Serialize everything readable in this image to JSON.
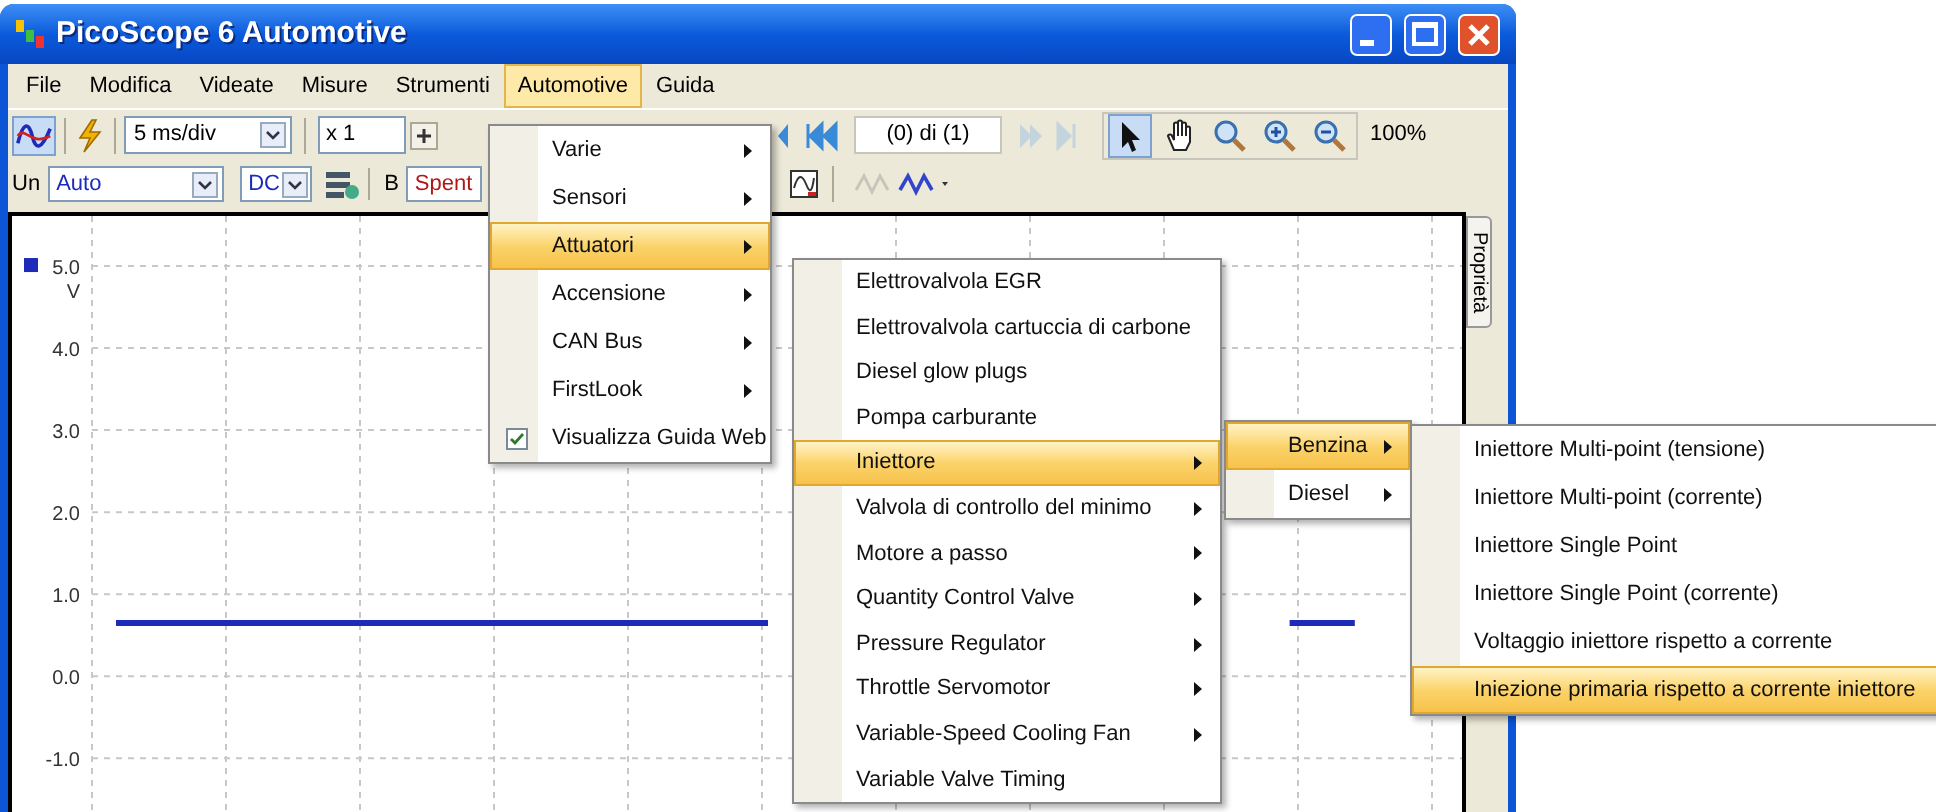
{
  "window": {
    "title": "PicoScope 6 Automotive"
  },
  "menu_bar": [
    {
      "label": "File",
      "selected": false
    },
    {
      "label": "Modifica",
      "selected": false
    },
    {
      "label": "Videate",
      "selected": false
    },
    {
      "label": "Misure",
      "selected": false
    },
    {
      "label": "Strumenti",
      "selected": false
    },
    {
      "label": "Automotive",
      "selected": true
    },
    {
      "label": "Guida",
      "selected": false
    }
  ],
  "toolbar": {
    "timebase": "5 ms/div",
    "multiplier": "x 1",
    "buffer": "(0) di (1)",
    "zoom": "100%",
    "tools": [
      {
        "kind": "pointer",
        "selected": true
      },
      {
        "kind": "hand",
        "selected": false
      },
      {
        "kind": "zoom",
        "selected": false
      },
      {
        "kind": "zoom_in",
        "selected": false
      },
      {
        "kind": "zoom_out",
        "selected": false
      }
    ]
  },
  "channel_bar": {
    "channel_a": "Un",
    "range": "Auto",
    "coupling": "DC",
    "channel_b": "B",
    "channel_b_range": "Spent"
  },
  "properties_tab": "Proprietà",
  "graph": {
    "chart_data": {
      "type": "line",
      "ylabel": "V",
      "grid": true,
      "ylim": [
        -1.85,
        5.61
      ],
      "yticks": [
        {
          "value": 5,
          "label": "5.0"
        },
        {
          "value": 4,
          "label": "4.0"
        },
        {
          "value": 3,
          "label": "3.0"
        },
        {
          "value": 2,
          "label": "2.0"
        },
        {
          "value": 1,
          "label": "1.0"
        },
        {
          "value": 0,
          "label": "0.0"
        },
        {
          "value": -1,
          "label": "-1.0"
        }
      ],
      "series": [
        {
          "color": "#1c2bb8",
          "values": [
            0.65,
            0.65,
            0.65,
            0.65,
            0.65,
            0.65,
            0.65,
            0.65,
            0.65,
            0.65,
            0.65,
            null,
            null,
            null,
            null,
            null,
            null,
            null,
            0.65,
            0.65,
            null
          ]
        }
      ]
    }
  },
  "menus": [
    {
      "items": [
        {
          "label": "Varie",
          "submenu": true,
          "selected": false,
          "kind": "item"
        },
        {
          "label": "Sensori",
          "submenu": true,
          "selected": false,
          "kind": "item"
        },
        {
          "label": "Attuatori",
          "submenu": true,
          "selected": true,
          "kind": "item"
        },
        {
          "label": "Accensione",
          "submenu": true,
          "selected": false,
          "kind": "item"
        },
        {
          "label": "CAN Bus",
          "submenu": true,
          "selected": false,
          "kind": "item"
        },
        {
          "label": "FirstLook",
          "submenu": true,
          "selected": false,
          "kind": "item"
        },
        {
          "label": "Visualizza Guida Web",
          "submenu": false,
          "selected": false,
          "kind": "checkbox",
          "checked": true
        }
      ]
    },
    {
      "items": [
        {
          "label": "Elettrovalvola EGR",
          "submenu": false,
          "selected": false,
          "kind": "item"
        },
        {
          "label": "Elettrovalvola cartuccia di carbone",
          "submenu": false,
          "selected": false,
          "kind": "item"
        },
        {
          "label": "Diesel glow plugs",
          "submenu": false,
          "selected": false,
          "kind": "item"
        },
        {
          "label": "Pompa carburante",
          "submenu": false,
          "selected": false,
          "kind": "item"
        },
        {
          "label": "Iniettore",
          "submenu": true,
          "selected": true,
          "kind": "item"
        },
        {
          "label": "Valvola di controllo del minimo",
          "submenu": true,
          "selected": false,
          "kind": "item"
        },
        {
          "label": "Motore a passo",
          "submenu": true,
          "selected": false,
          "kind": "item"
        },
        {
          "label": "Quantity Control Valve",
          "submenu": true,
          "selected": false,
          "kind": "item"
        },
        {
          "label": "Pressure Regulator",
          "submenu": true,
          "selected": false,
          "kind": "item"
        },
        {
          "label": "Throttle Servomotor",
          "submenu": true,
          "selected": false,
          "kind": "item"
        },
        {
          "label": "Variable-Speed Cooling Fan",
          "submenu": true,
          "selected": false,
          "kind": "item"
        },
        {
          "label": "Variable Valve Timing",
          "submenu": false,
          "selected": false,
          "kind": "item"
        }
      ]
    },
    {
      "items": [
        {
          "label": "Benzina",
          "submenu": true,
          "selected": true,
          "kind": "item"
        },
        {
          "label": "Diesel",
          "submenu": true,
          "selected": false,
          "kind": "item"
        }
      ]
    },
    {
      "items": [
        {
          "label": "Iniettore Multi-point (tensione)",
          "submenu": false,
          "selected": false,
          "kind": "item"
        },
        {
          "label": "Iniettore Multi-point (corrente)",
          "submenu": false,
          "selected": false,
          "kind": "item"
        },
        {
          "label": "Iniettore Single Point",
          "submenu": false,
          "selected": false,
          "kind": "item"
        },
        {
          "label": "Iniettore Single Point (corrente)",
          "submenu": false,
          "selected": false,
          "kind": "item"
        },
        {
          "label": "Voltaggio iniettore rispetto a corrente",
          "submenu": false,
          "selected": false,
          "kind": "item"
        },
        {
          "label": "Iniezione primaria rispetto a corrente iniettore",
          "submenu": false,
          "selected": true,
          "kind": "item"
        }
      ]
    }
  ]
}
